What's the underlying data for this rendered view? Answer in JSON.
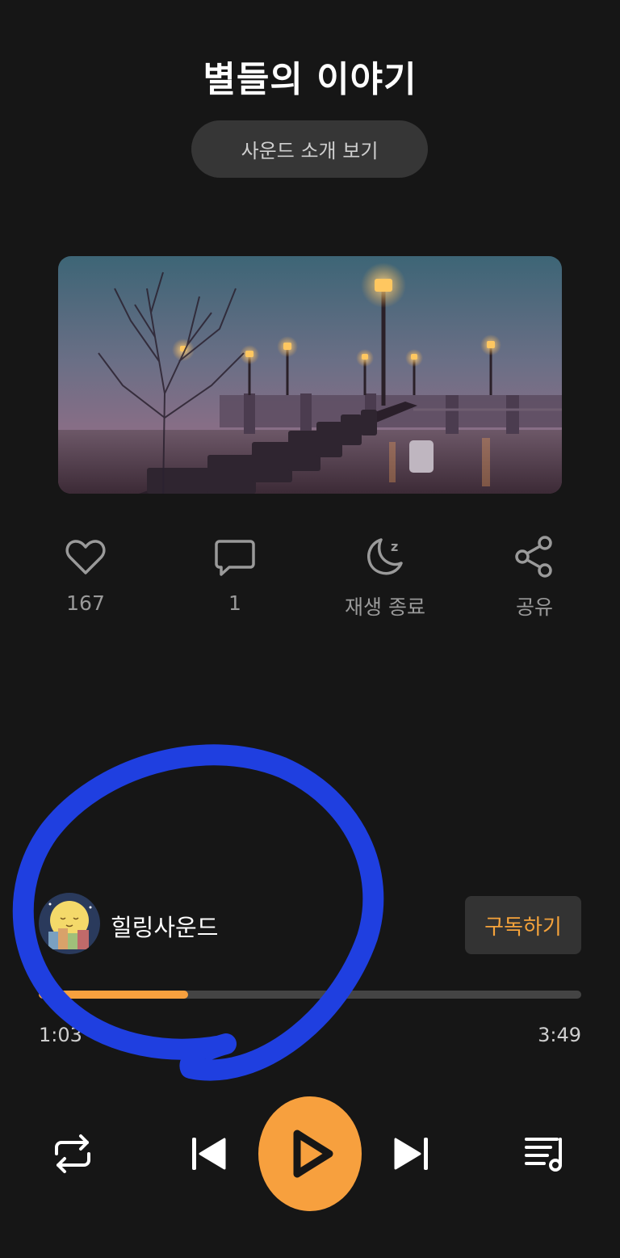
{
  "header": {
    "title": "별들의 이야기",
    "intro_button": "사운드 소개 보기"
  },
  "cover": {
    "image": "misty-pier-with-lamps-at-dusk"
  },
  "actions": [
    {
      "icon": "heart-icon",
      "label": "167"
    },
    {
      "icon": "comment-icon",
      "label": "1"
    },
    {
      "icon": "sleep-timer-icon",
      "label": "재생 종료"
    },
    {
      "icon": "share-icon",
      "label": "공유"
    }
  ],
  "channel": {
    "name": "힐링사운드",
    "subscribe": "구독하기"
  },
  "player": {
    "current_time": "1:03",
    "total_time": "3:49",
    "progress": 0.275
  },
  "controls": [
    "repeat-icon",
    "previous-icon",
    "play-icon",
    "next-icon",
    "playlist-icon"
  ],
  "colors": {
    "accent": "#f7a03e",
    "background": "#161616",
    "annotation": "#1f3fe0"
  }
}
